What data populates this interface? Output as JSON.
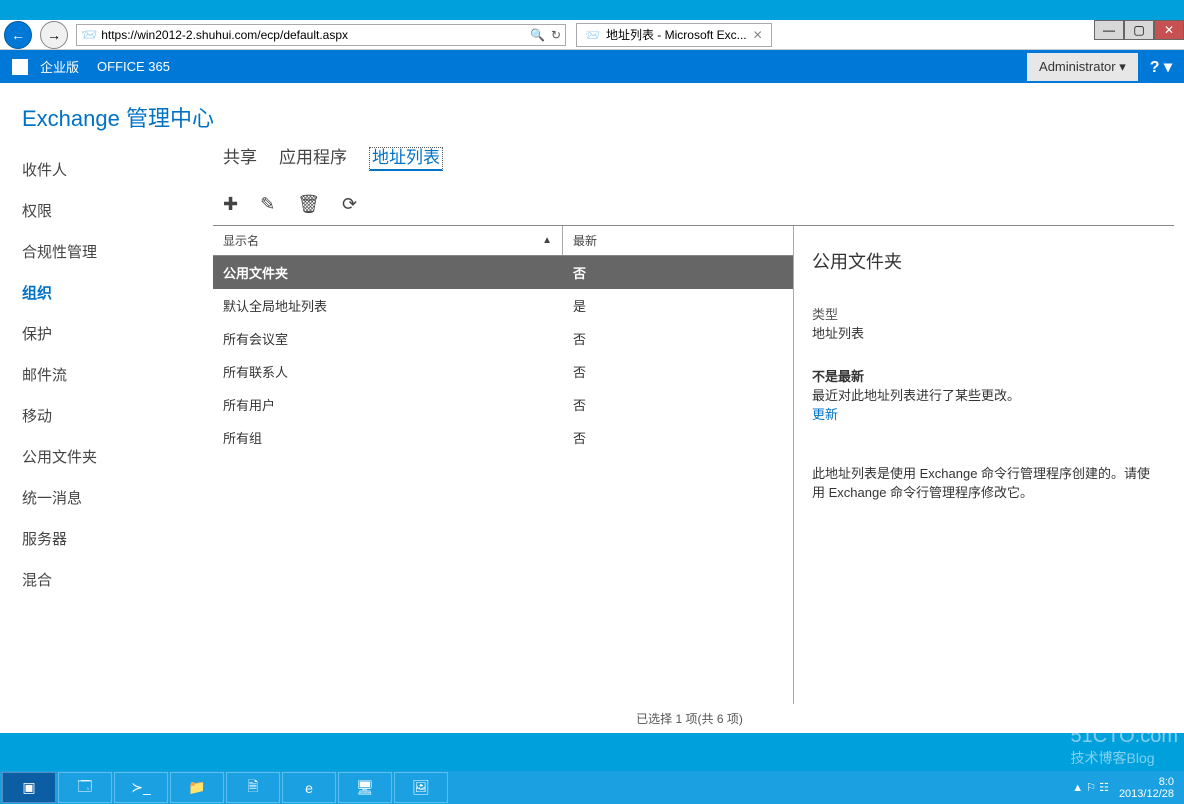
{
  "window": {
    "min": "—",
    "max": "▢",
    "close": "✕"
  },
  "browser": {
    "url_pre": "https://",
    "url_host": "win2012-2.shuhui.com",
    "url_path": "/ecp/default.aspx",
    "search_glyph": "🔍",
    "refresh_glyph": "↻",
    "tab_title": "地址列表 - Microsoft Exc...",
    "home_glyph": "⌂",
    "fav_glyph": "★",
    "gear_glyph": "⚙"
  },
  "topbar": {
    "edition": "企业版",
    "office": "OFFICE 365",
    "admin": "Administrator ▾",
    "help": "? ▾"
  },
  "eac_title": "Exchange 管理中心",
  "sidebar": [
    "收件人",
    "权限",
    "合规性管理",
    "组织",
    "保护",
    "邮件流",
    "移动",
    "公用文件夹",
    "统一消息",
    "服务器",
    "混合"
  ],
  "sidebar_active": 3,
  "tabs": [
    "共享",
    "应用程序",
    "地址列表"
  ],
  "tabs_active": 2,
  "toolbar": {
    "add": "✚",
    "edit": "✎",
    "del": "🗑",
    "refresh": "⟳"
  },
  "columns": {
    "name": "显示名",
    "latest": "最新"
  },
  "rows": [
    {
      "name": "公用文件夹",
      "latest": "否",
      "selected": true
    },
    {
      "name": "默认全局地址列表",
      "latest": "是"
    },
    {
      "name": "所有会议室",
      "latest": "否"
    },
    {
      "name": "所有联系人",
      "latest": "否"
    },
    {
      "name": "所有用户",
      "latest": "否"
    },
    {
      "name": "所有组",
      "latest": "否"
    }
  ],
  "status": "已选择 1 项(共 6 项)",
  "detail": {
    "title": "公用文件夹",
    "type_label": "类型",
    "type_value": "地址列表",
    "notlatest_label": "不是最新",
    "notlatest_text": "最近对此地址列表进行了某些更改。",
    "update_link": "更新",
    "note": "此地址列表是使用 Exchange 命令行管理程序创建的。请使用 Exchange 命令行管理程序修改它。"
  },
  "taskbar": {
    "time": "8:0",
    "date": "2013/12/28",
    "watermark1": "51CTO.com",
    "watermark2": "技术博客Blog"
  }
}
